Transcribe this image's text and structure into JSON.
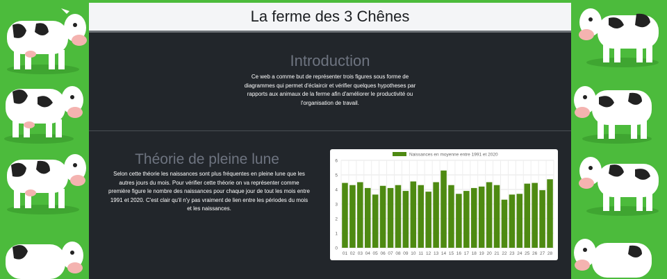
{
  "header": {
    "title": "La ferme des 3 Chênes"
  },
  "intro": {
    "title": "Introduction",
    "text": "Ce web a comme but de représenter trois figures sous forme de diagrammes qui permet d'éclaircir et vérifier quelques hypotheses par rapports aux animaux de la ferme afin d'améliorer le productivité ou l'organisation de travail."
  },
  "theory": {
    "title": "Théorie de pleine lune",
    "text": "Selon cette théorie les naissances sont plus fréquentes en pleine lune que les autres jours du mois. Pour vérifier cette théorie on va représenter comme première figure le nombre des naissances pour chaque jour de tout les mois entre 1991 et 2020. C'est clair qu'il n'y pas vraiment de lien entre les périodes du mois et les naissances."
  },
  "colors": {
    "bar": "#4e8a12",
    "background": "#4cbb3c",
    "panel": "#22262b"
  },
  "chart_data": {
    "type": "bar",
    "categories": [
      "01",
      "02",
      "03",
      "04",
      "05",
      "06",
      "07",
      "08",
      "09",
      "10",
      "11",
      "12",
      "13",
      "14",
      "15",
      "16",
      "17",
      "18",
      "19",
      "20",
      "21",
      "22",
      "23",
      "24",
      "25",
      "26",
      "27",
      "28"
    ],
    "series": [
      {
        "name": "Naissances en moyenne entre 1991 et 2020",
        "values": [
          4.45,
          4.3,
          4.5,
          4.1,
          3.65,
          4.25,
          4.1,
          4.3,
          3.9,
          4.55,
          4.3,
          3.85,
          4.5,
          5.3,
          4.3,
          3.7,
          3.9,
          4.1,
          4.2,
          4.5,
          4.3,
          3.3,
          3.65,
          3.7,
          4.4,
          4.45,
          3.95,
          4.7
        ]
      }
    ],
    "yticks": [
      "0",
      "1",
      "2",
      "3",
      "4",
      "5",
      "6"
    ],
    "ylim": [
      0,
      6
    ],
    "legend": "top",
    "grid": true
  }
}
